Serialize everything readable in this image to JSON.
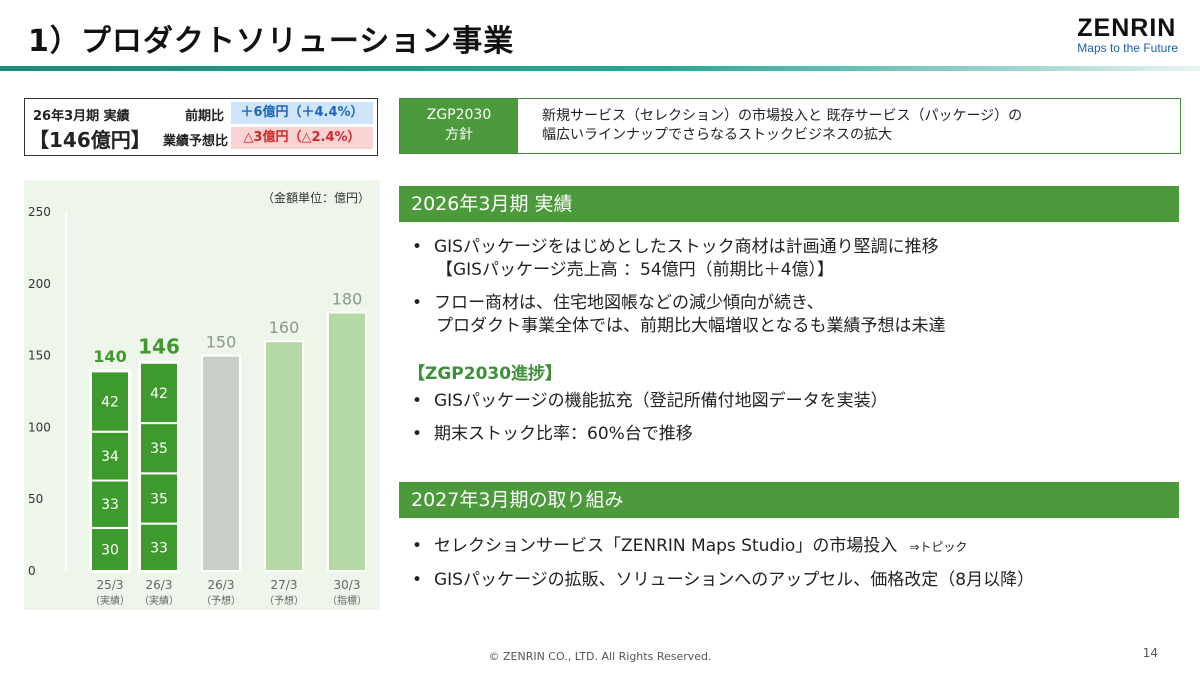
{
  "header": {
    "title": "1）プロダクトソリューション事業",
    "logo_name": "ZENRIN",
    "logo_tagline": "Maps to the Future"
  },
  "summary": {
    "label": "26年3月期 実績",
    "value": "【146億円】",
    "yoy_label": "前期比",
    "yoy_value": "＋6億円（＋4.4%）",
    "forecast_label": "業績予想比",
    "forecast_value": "△3億円（△2.4%）",
    "colors": {
      "yoy_bg": "#cfe6fa",
      "yoy_text": "#1f64c0",
      "forecast_bg": "#fbd3d3",
      "forecast_text": "#d02828"
    }
  },
  "policy": {
    "label_line1": "ZGP2030",
    "label_line2": "方針",
    "text_line1": "新規サービス（セレクション）の市場投入と 既存サービス（パッケージ）の",
    "text_line2": "幅広いラインナップでさらなるストックビジネスの拡大"
  },
  "section1": {
    "title": "2026年3月期 実績",
    "bullet1_line1": "GISパッケージをはじめとしたストック商材は計画通り堅調に推移",
    "bullet1_line2": "【GISパッケージ売上高 ：54億円（前期比＋4億）】",
    "bullet2_line1": "フロー商材は、住宅地図帳などの減少傾向が続き、",
    "bullet2_line2": "プロダクト事業全体では、前期比大幅増収となるも業績予想は未達",
    "progress_title": "【ZGP2030進捗】",
    "progress1": "GISパッケージの機能拡充（登記所備付地図データを実装）",
    "progress2": "期末ストック比率：60%台で推移"
  },
  "section2": {
    "title": "2027年3月期の取り組み",
    "bullet1": "セレクションサービス「ZENRIN Maps Studio」の市場投入",
    "bullet1_topic": "⇒トピック",
    "bullet2": "GISパッケージの拡販、ソリューションへのアップセル、価格改定（8月以降）"
  },
  "footer": {
    "copyright": "© ZENRIN CO., LTD. All Rights Reserved.",
    "page": "14"
  },
  "chart_data": {
    "type": "bar",
    "unit_label": "（金額単位：億円）",
    "ylim": [
      0,
      250
    ],
    "yticks": [
      0,
      50,
      100,
      150,
      200,
      250
    ],
    "categories": [
      "25/3",
      "26/3",
      "26/3",
      "27/3",
      "30/3"
    ],
    "sublabels": [
      "（実績）",
      "（実績）",
      "（予想）",
      "（予想）",
      "（指標）"
    ],
    "totals": [
      140,
      146,
      150,
      160,
      180
    ],
    "stacked": [
      [
        30,
        33,
        34,
        42
      ],
      [
        33,
        35,
        35,
        42
      ]
    ],
    "colors": {
      "actual": "#3f9a2e",
      "forecast": "#c9cfc7",
      "target": "#b5d9a5",
      "grid": "#ffffff",
      "total_actual": "#3f9a2e",
      "total_other": "#8a9a86"
    }
  }
}
